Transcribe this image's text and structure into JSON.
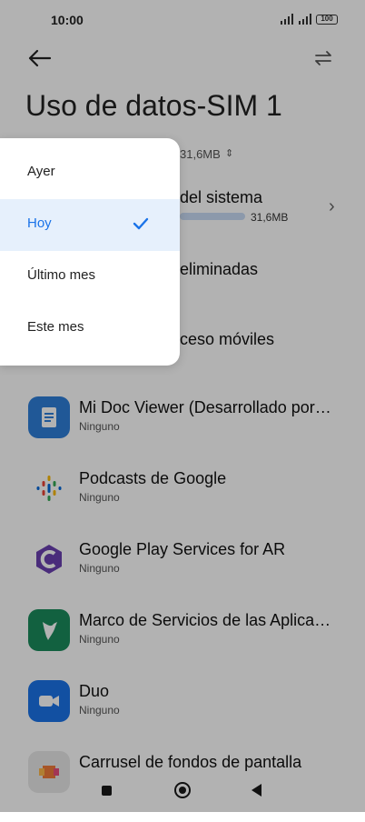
{
  "status_bar": {
    "time": "10:00",
    "battery": "100"
  },
  "header": {
    "title": "Uso de datos-SIM 1",
    "total": "31,6MB"
  },
  "background_rows": [
    {
      "title": "del sistema",
      "size": "31,6MB"
    },
    {
      "title": "eliminadas"
    },
    {
      "title": "ceso móviles"
    }
  ],
  "apps": [
    {
      "name": "Mi Doc Viewer (Desarrollado por…",
      "usage": "Ninguno",
      "icon": "mi-doc-viewer-icon",
      "color": "#2f7fd8"
    },
    {
      "name": "Podcasts de Google",
      "usage": "Ninguno",
      "icon": "google-podcasts-icon",
      "color": "#ffffff"
    },
    {
      "name": "Google Play Services for AR",
      "usage": "Ninguno",
      "icon": "arcore-icon",
      "color": "#ffffff"
    },
    {
      "name": "Marco de Servicios de las Aplica…",
      "usage": "Ninguno",
      "icon": "hummingbird-icon",
      "color": "#1a8c5c"
    },
    {
      "name": "Duo",
      "usage": "Ninguno",
      "icon": "duo-video-icon",
      "color": "#1a73e8"
    },
    {
      "name": "Carrusel de fondos de pantalla",
      "usage": "",
      "icon": "wallpaper-carousel-icon",
      "color": "#e8e8e8"
    }
  ],
  "dropdown": {
    "options": [
      {
        "label": "Ayer",
        "selected": false
      },
      {
        "label": "Hoy",
        "selected": true
      },
      {
        "label": "Último mes",
        "selected": false
      },
      {
        "label": "Este mes",
        "selected": false
      }
    ],
    "accent": "#1a73e8"
  }
}
